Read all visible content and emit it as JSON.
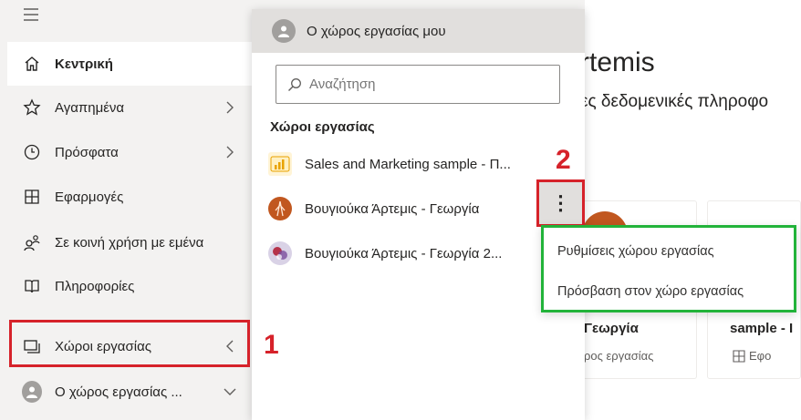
{
  "nav": {
    "items": [
      {
        "label": "Κεντρική",
        "icon": "home-icon"
      },
      {
        "label": "Αγαπημένα",
        "icon": "star-icon",
        "chevron": ">"
      },
      {
        "label": "Πρόσφατα",
        "icon": "clock-icon",
        "chevron": ">"
      },
      {
        "label": "Εφαρμογές",
        "icon": "apps-icon"
      },
      {
        "label": "Σε κοινή χρήση με εμένα",
        "icon": "shared-icon"
      },
      {
        "label": "Πληροφορίες",
        "icon": "book-icon"
      },
      {
        "label": "Χώροι εργασίας",
        "icon": "workspaces-icon",
        "chevron": "<"
      },
      {
        "label": "Ο χώρος εργασίας ...",
        "icon": "avatar-icon",
        "chevron": "⌄"
      }
    ]
  },
  "flyout": {
    "header": "Ο χώρος εργασίας μου",
    "search_placeholder": "Αναζήτηση",
    "section_title": "Χώροι εργασίας",
    "workspaces": [
      {
        "label": "Sales and Marketing sample - Π...",
        "icon": "report-icon"
      },
      {
        "label": "Βουγιούκα Άρτεμις - Γεωργία",
        "icon": "workspace-logo-icon"
      },
      {
        "label": "Βουγιούκα Άρτεμις - Γεωργία 2...",
        "icon": "workspace-logo-icon"
      }
    ],
    "more_button": "⋮"
  },
  "context_menu": {
    "items": [
      "Ρυθμίσεις χώρου εργασίας",
      "Πρόσβαση στον χώρο εργασίας"
    ]
  },
  "background": {
    "title_fragment": "rtemis",
    "subtitle_fragment": "ες δεδομενικές πληροφο",
    "card1": {
      "title": "Γεωργία",
      "subtitle": "ρος εργασίας"
    },
    "card2": {
      "title": "sample - I",
      "subtitle": "Εφο"
    }
  },
  "annotations": {
    "label_1": "1",
    "label_2": "2"
  },
  "colors": {
    "red": "#d6222a",
    "green": "#22b33a",
    "accent": "#e8a200"
  }
}
